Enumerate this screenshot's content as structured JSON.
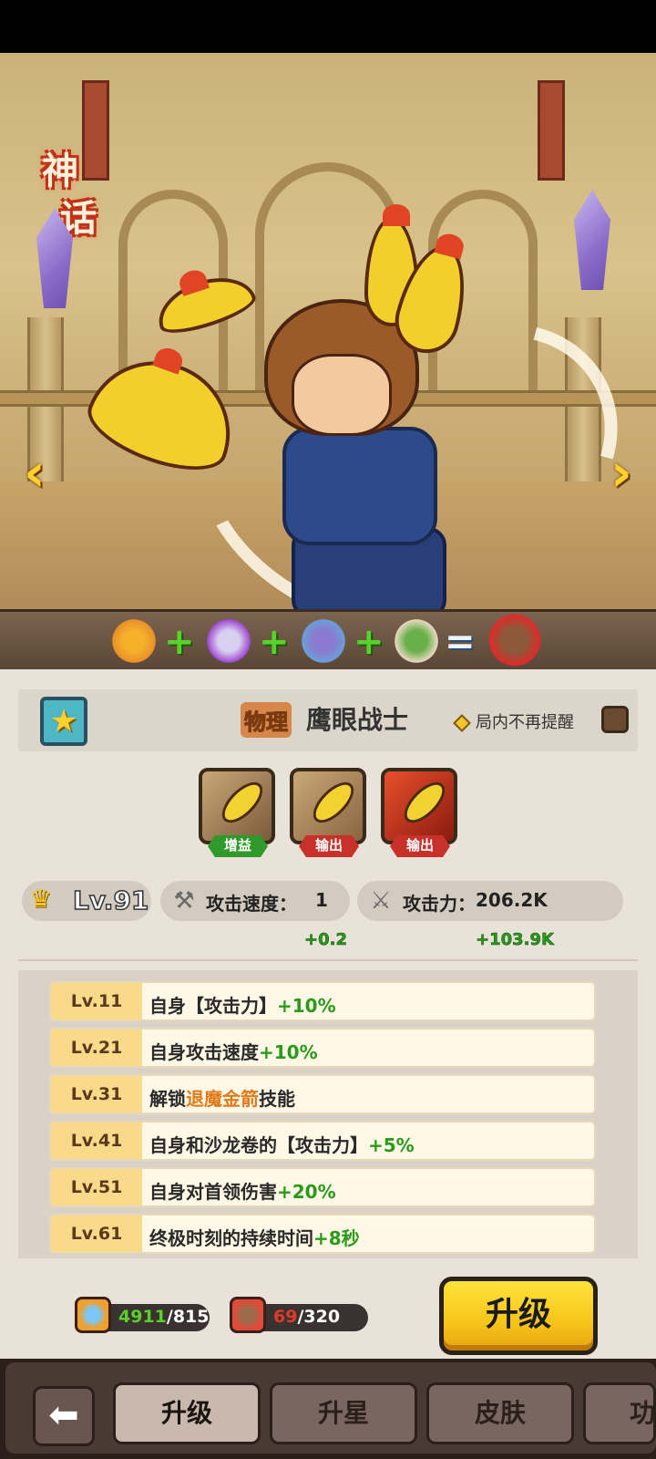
{
  "hero": {
    "rarity_chars": [
      "神",
      "话"
    ],
    "prev_arrow": "‹",
    "next_arrow": "›",
    "combo_ops": [
      "+",
      "+",
      "+",
      "="
    ]
  },
  "panel": {
    "damage_type": "物理",
    "hero_name": "鹰眼战士",
    "no_remind_label": "局内不再提醒",
    "skills": [
      {
        "tag": "增益",
        "tag_color": "#2f9a2a"
      },
      {
        "tag": "输出",
        "tag_color": "#c8302a"
      },
      {
        "tag": "输出",
        "tag_color": "#c8302a"
      }
    ],
    "level": "Lv.91",
    "attack_speed_label": "攻击速度：",
    "attack_speed_value": "1",
    "attack_speed_bonus": "+0.2",
    "attack_power_label": "攻击力：",
    "attack_power_value": "206.2K",
    "attack_power_bonus": "+103.9K",
    "level_rows": [
      {
        "lv": "Lv.11",
        "text": "自身【攻击力】",
        "highlight": "+10%"
      },
      {
        "lv": "Lv.21",
        "text": "自身攻击速度",
        "highlight": "+10%"
      },
      {
        "lv": "Lv.31",
        "text_before": "解锁",
        "skill": "退魔金箭",
        "text_after": "技能"
      },
      {
        "lv": "Lv.41",
        "text": "自身和沙龙卷的【攻击力】",
        "highlight": "+5%"
      },
      {
        "lv": "Lv.51",
        "text": "自身对首领伤害",
        "highlight": "+20%"
      },
      {
        "lv": "Lv.61",
        "text": "终极时刻的持续时间",
        "highlight": "+8秒"
      }
    ],
    "resources": {
      "potion_have": "4911",
      "potion_need": "/815",
      "shard_have": "69",
      "shard_need": "/320"
    },
    "upgrade_label": "升级"
  },
  "tabs": {
    "back_icon": "back-arrow-icon",
    "items": [
      "升级",
      "升星",
      "皮肤",
      "功"
    ]
  },
  "colors": {
    "accent_yellow": "#f6c41a",
    "positive_green": "#2a9a1a",
    "skill_orange": "#e07a1a",
    "shard_red": "#e23a2a"
  }
}
